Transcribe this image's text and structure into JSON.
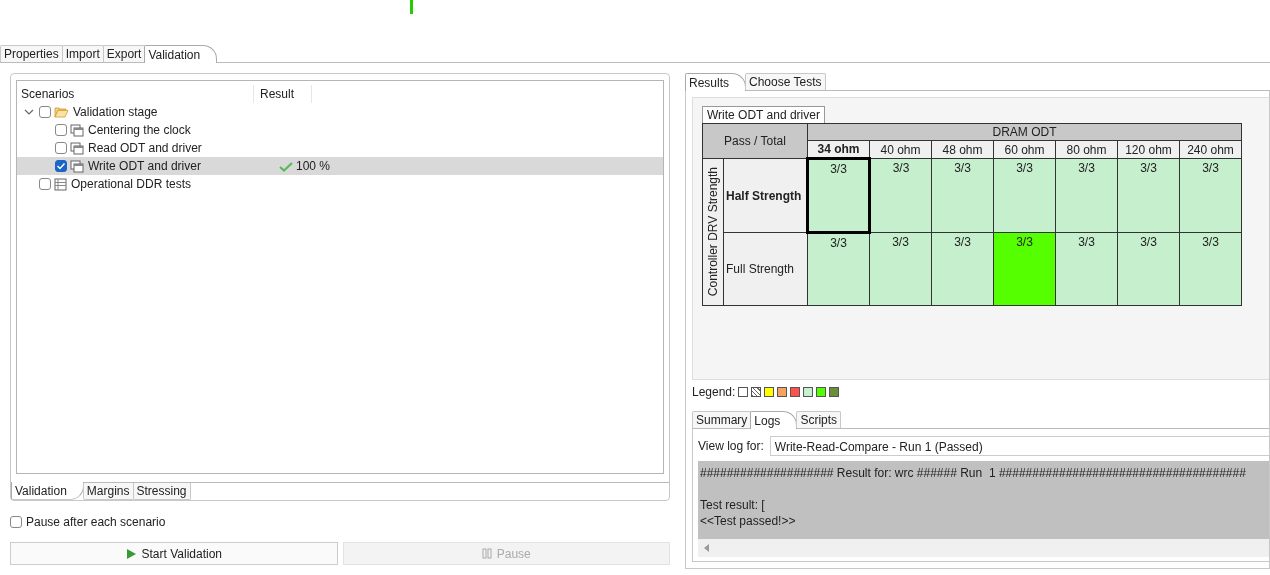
{
  "top_tabs": [
    {
      "label": "Properties",
      "selected": false
    },
    {
      "label": "Import",
      "selected": false
    },
    {
      "label": "Export",
      "selected": false
    },
    {
      "label": "Validation",
      "selected": true
    }
  ],
  "scenarios": {
    "columns": [
      "Scenarios",
      "Result"
    ],
    "items": [
      {
        "label": "Validation stage",
        "kind": "folder",
        "checked": false,
        "selected": false,
        "expanded": true,
        "children": [
          {
            "label": "Centering the clock",
            "kind": "test",
            "checked": false,
            "selected": false
          },
          {
            "label": "Read ODT and driver",
            "kind": "test",
            "checked": false,
            "selected": false
          },
          {
            "label": "Write ODT and driver",
            "kind": "test",
            "checked": true,
            "selected": true,
            "result": "100 %"
          }
        ]
      },
      {
        "label": "Operational DDR tests",
        "kind": "suite",
        "checked": false,
        "selected": false
      }
    ]
  },
  "left_tabs": [
    {
      "label": "Validation",
      "selected": true
    },
    {
      "label": "Margins",
      "selected": false
    },
    {
      "label": "Stressing",
      "selected": false
    }
  ],
  "pause_after_each_scenario": {
    "label": "Pause after each scenario",
    "checked": false
  },
  "buttons": [
    {
      "label": "Start Validation",
      "kind": "start",
      "disabled": false
    },
    {
      "label": "Pause",
      "kind": "pause",
      "disabled": true
    }
  ],
  "right_tabs": [
    {
      "label": "Results",
      "selected": true
    },
    {
      "label": "Choose Tests",
      "selected": false
    }
  ],
  "result_grid": {
    "title": "Write ODT and driver",
    "corner": "Pass / Total",
    "column_group": "DRAM ODT",
    "row_group": "Controller DRV Strength",
    "columns": [
      {
        "label": "34 ohm",
        "selected": true
      },
      {
        "label": "40 ohm",
        "selected": false
      },
      {
        "label": "48 ohm",
        "selected": false
      },
      {
        "label": "60 ohm",
        "selected": false
      },
      {
        "label": "80 ohm",
        "selected": false
      },
      {
        "label": "120 ohm",
        "selected": false
      },
      {
        "label": "240 ohm",
        "selected": false
      }
    ],
    "rows": [
      {
        "label": "Half Strength",
        "selected": true,
        "cells": [
          {
            "text": "3/3",
            "color": "#c6efce",
            "selected": true
          },
          {
            "text": "3/3",
            "color": "#c6efce",
            "selected": false
          },
          {
            "text": "3/3",
            "color": "#c6efce",
            "selected": false
          },
          {
            "text": "3/3",
            "color": "#c6efce",
            "selected": false
          },
          {
            "text": "3/3",
            "color": "#c6efce",
            "selected": false
          },
          {
            "text": "3/3",
            "color": "#c6efce",
            "selected": false
          },
          {
            "text": "3/3",
            "color": "#c6efce",
            "selected": false
          }
        ]
      },
      {
        "label": "Full Strength",
        "selected": false,
        "cells": [
          {
            "text": "3/3",
            "color": "#c6efce",
            "selected": false
          },
          {
            "text": "3/3",
            "color": "#c6efce",
            "selected": false
          },
          {
            "text": "3/3",
            "color": "#c6efce",
            "selected": false
          },
          {
            "text": "3/3",
            "color": "#55ff00",
            "selected": false
          },
          {
            "text": "3/3",
            "color": "#c6efce",
            "selected": false
          },
          {
            "text": "3/3",
            "color": "#c6efce",
            "selected": false
          },
          {
            "text": "3/3",
            "color": "#c6efce",
            "selected": false
          }
        ]
      }
    ]
  },
  "legend": {
    "label": "Legend:",
    "items": [
      {
        "kind": "solid",
        "color": "#ffffff"
      },
      {
        "kind": "hatched",
        "color": "#ffffff"
      },
      {
        "kind": "solid",
        "color": "#ffff00"
      },
      {
        "kind": "solid",
        "color": "#f4a460"
      },
      {
        "kind": "solid",
        "color": "#ff5050"
      },
      {
        "kind": "solid",
        "color": "#c6efce"
      },
      {
        "kind": "solid",
        "color": "#55ff00"
      },
      {
        "kind": "solid",
        "color": "#6b8e3a"
      }
    ]
  },
  "log_tabs": [
    {
      "label": "Summary",
      "selected": false
    },
    {
      "label": "Logs",
      "selected": true
    },
    {
      "label": "Scripts",
      "selected": false
    }
  ],
  "log": {
    "view_label": "View log for:",
    "run": "Write-Read-Compare - Run 1 (Passed)",
    "lines": [
      "#################### Result for: wrc ###### Run  1 #####################################",
      "Test result: [",
      "<<Test passed!>>"
    ]
  }
}
